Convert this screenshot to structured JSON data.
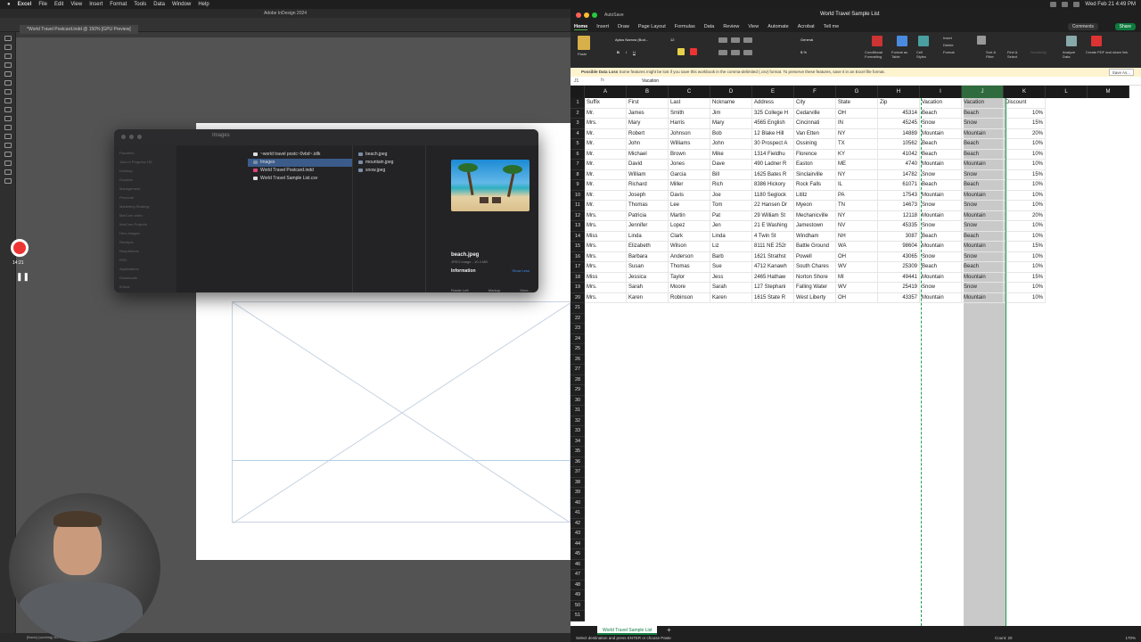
{
  "menubar": {
    "apple": "",
    "app": "Excel",
    "items": [
      "File",
      "Edit",
      "View",
      "Insert",
      "Format",
      "Tools",
      "Data",
      "Window",
      "Help"
    ],
    "clock": "Wed Feb 21  4:49 PM"
  },
  "indesign": {
    "title": "Adobe InDesign 2024",
    "tab": "*World Travel Postcard.indd @ 150% [GPU Preview]",
    "status": "[Basic] (working)   No errors"
  },
  "finder": {
    "title": "Images",
    "sidebar": [
      "Favorites",
      "Jobs in Progress HD",
      "Desktop",
      "Dropbox",
      "Management",
      "Personal",
      "Marketing Strategy",
      "MarCom video",
      "MarCom Projects",
      "Hero images",
      "Receipts",
      "Requisitions",
      "RSD",
      "Applications",
      "Downloads",
      "iCloud"
    ],
    "col1": [
      {
        "name": "~world travel postc~0vbd~.idlk",
        "type": "doc"
      },
      {
        "name": "Images",
        "type": "folder",
        "selected": true
      },
      {
        "name": "World Travel Postcard.indd",
        "type": "indd"
      },
      {
        "name": "World Travel Sample List.csv",
        "type": "doc"
      }
    ],
    "col2": [
      "beach.jpeg",
      "mountain.jpeg",
      "snow.jpeg"
    ],
    "preview": {
      "name": "beach.jpeg",
      "sub": "JPEG image - 10.4 MB",
      "info": "Information",
      "show_less": "Show Less",
      "actions": [
        "Rotate Left",
        "Markup",
        "More..."
      ]
    }
  },
  "recorder": {
    "time": "14:21"
  },
  "excel": {
    "autosave": "AutoSave",
    "doc_title": "World Travel Sample List",
    "menu": [
      "Home",
      "Insert",
      "Draw",
      "Page Layout",
      "Formulas",
      "Data",
      "Review",
      "View",
      "Automate",
      "Acrobat",
      "Tell me"
    ],
    "comments": "Comments",
    "share": "Share",
    "ribbon": {
      "paste": "Paste",
      "font": "Aptos Narrow (Bod...",
      "size": "12",
      "number_format": "General",
      "conditional": "Conditional Formatting",
      "format_table": "Format as Table",
      "cell_styles": "Cell Styles",
      "insert": "Insert",
      "delete": "Delete",
      "format": "Format",
      "sort": "Sort & Filter",
      "find": "Find & Select",
      "sensitivity": "Sensitivity",
      "analyze": "Analyze Data",
      "create_pdf": "Create PDF and share link"
    },
    "notice": {
      "bold": "Possible Data Loss",
      "text": "Some features might be lost if you save this workbook in the comma-delimited (.csv) format. To preserve these features, save it in an Excel file format.",
      "button": "Save As..."
    },
    "namebox": "J1",
    "fx": "fx",
    "formula": "Vacation",
    "columns": [
      "A",
      "B",
      "C",
      "D",
      "E",
      "F",
      "G",
      "H",
      "I",
      "J",
      "K",
      "L",
      "M"
    ],
    "headers": [
      "Suffix",
      "First",
      "Last",
      "Nckname",
      "Address",
      "City",
      "State",
      "Zip",
      "Vacation",
      "Vacation",
      "Discount"
    ],
    "rows": [
      [
        "Mr.",
        "James",
        "Smith",
        "Jim",
        "325 College H",
        "Cedarville",
        "OH",
        "45314",
        "Beach",
        "Beach",
        "10%"
      ],
      [
        "Mrs.",
        "Mary",
        "Harris",
        "Mary",
        "4565 English",
        "Cincinnati",
        "IN",
        "45245",
        "Snow",
        "Snow",
        "15%"
      ],
      [
        "Mr.",
        "Robert",
        "Johnson",
        "Bob",
        "12 Blake Hill",
        "Van Etten",
        "NY",
        "14889",
        "Mountain",
        "Mountain",
        "20%"
      ],
      [
        "Mr.",
        "John",
        "Williams",
        "John",
        "30 Prospect A",
        "Ossining",
        "TX",
        "10562",
        "Beach",
        "Beach",
        "10%"
      ],
      [
        "Mr.",
        "Michael",
        "Brown",
        "Mike",
        "1314 Fieldhu",
        "Florence",
        "KY",
        "41042",
        "Beach",
        "Beach",
        "10%"
      ],
      [
        "Mr.",
        "David",
        "Jones",
        "Dave",
        "490 Ladner R",
        "Easton",
        "ME",
        "4740",
        "Mountain",
        "Mountain",
        "10%"
      ],
      [
        "Mr.",
        "William",
        "Garcia",
        "Bill",
        "1625 Bates R",
        "Sinclairville",
        "NY",
        "14782",
        "Snow",
        "Snow",
        "15%"
      ],
      [
        "Mr.",
        "Richard",
        "Miller",
        "Rich",
        "8386 Hickory",
        "Rock Falls",
        "IL",
        "61071",
        "Beach",
        "Beach",
        "10%"
      ],
      [
        "Mr.",
        "Joseph",
        "Davis",
        "Joe",
        "1180 Seglock",
        "Lititz",
        "PA",
        "17543",
        "Mountain",
        "Mountain",
        "10%"
      ],
      [
        "Mr.",
        "Thomas",
        "Lee",
        "Tom",
        "22 Hansen Dr",
        "Myeon",
        "TN",
        "14673",
        "Snow",
        "Snow",
        "10%"
      ],
      [
        "Mrs.",
        "Patricia",
        "Martin",
        "Pat",
        "29 William St",
        "Mechanicville",
        "NY",
        "12118",
        "Mountain",
        "Mountain",
        "20%"
      ],
      [
        "Mrs.",
        "Jennifer",
        "Lopez",
        "Jen",
        "21 E Washing",
        "Jamestown",
        "NV",
        "45335",
        "Snow",
        "Snow",
        "10%"
      ],
      [
        "Miss",
        "Linda",
        "Clark",
        "Linda",
        "4 Twin St",
        "Windham",
        "NH",
        "3087",
        "Beach",
        "Beach",
        "10%"
      ],
      [
        "Mrs.",
        "Elizabeth",
        "Wilson",
        "Liz",
        "8111 NE 252r",
        "Battle Ground",
        "WA",
        "98604",
        "Mountain",
        "Mountain",
        "15%"
      ],
      [
        "Mrs.",
        "Barbara",
        "Anderson",
        "Barb",
        "1621 Strathst",
        "Powell",
        "OH",
        "43065",
        "Snow",
        "Snow",
        "10%"
      ],
      [
        "Mrs.",
        "Susan",
        "Thomas",
        "Sue",
        "4712 Kanawh",
        "South Chares",
        "WV",
        "25309",
        "Beach",
        "Beach",
        "10%"
      ],
      [
        "Miss",
        "Jessica",
        "Taylor",
        "Jess",
        "2465 Hathaw",
        "Norton Shore",
        "MI",
        "49441",
        "Mountain",
        "Mountain",
        "15%"
      ],
      [
        "Mrs.",
        "Sarah",
        "Moore",
        "Sarah",
        "127 Stephani",
        "Falling Water",
        "WV",
        "25419",
        "Snow",
        "Snow",
        "10%"
      ],
      [
        "Mrs.",
        "Karen",
        "Robinson",
        "Karen",
        "1615 State R",
        "West Liberty",
        "OH",
        "43357",
        "Mountain",
        "Mountain",
        "10%"
      ]
    ],
    "total_rows": 51,
    "sheet_tab": "World Travel Sample List",
    "status": "Select destination and press ENTER or choose Paste",
    "count": "Count: 20",
    "zoom": "170%"
  }
}
